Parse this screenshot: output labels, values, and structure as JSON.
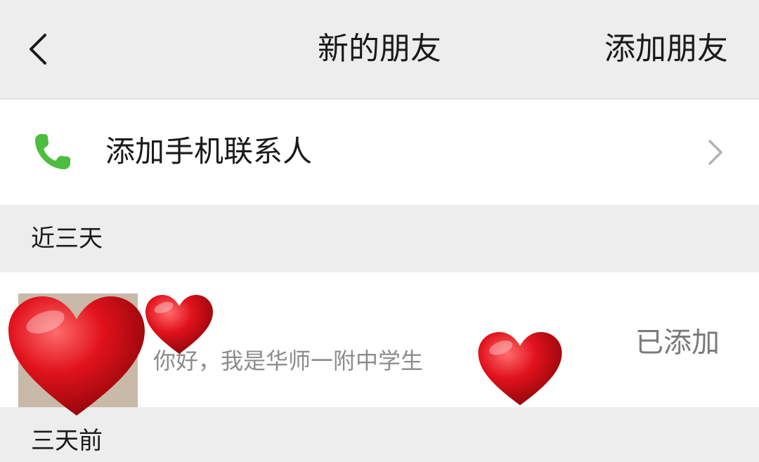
{
  "navbar": {
    "title": "新的朋友",
    "action_label": "添加朋友",
    "back_icon": "chevron-left-icon"
  },
  "phone_contacts": {
    "label": "添加手机联系人",
    "icon": "phone-icon",
    "icon_color": "#4cbd3f"
  },
  "sections": [
    {
      "title": "近三天",
      "items": [
        {
          "message": "你好，我是华师一附中学生",
          "status": "已添加"
        }
      ]
    },
    {
      "title": "三天前",
      "items": []
    }
  ],
  "colors": {
    "background": "#ededed",
    "row_background": "#ffffff",
    "heart": "#e1121c"
  }
}
